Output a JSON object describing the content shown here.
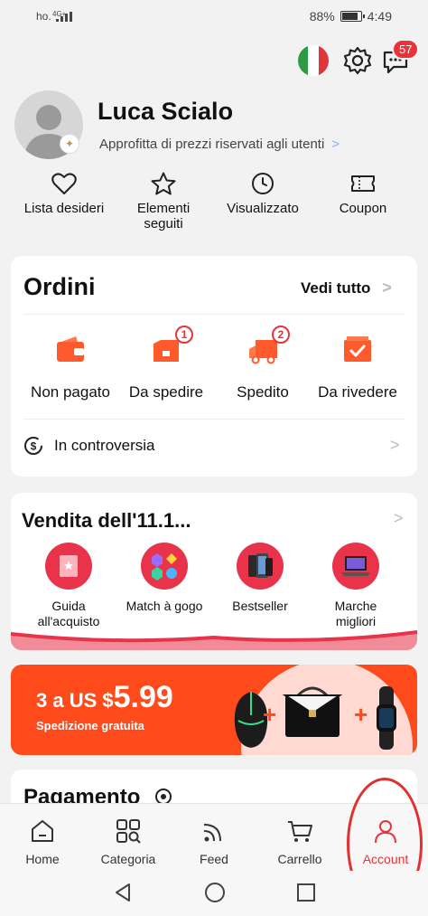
{
  "status_bar": {
    "carrier": "ho.",
    "network": "4G+",
    "battery": "88%",
    "time": "4:49",
    "battery_level": 0.88
  },
  "top_icons": {
    "flag": "italy-flag-icon",
    "settings": "gear-icon",
    "messages": "chat-icon",
    "messages_badge": "57"
  },
  "profile": {
    "name": "Luca Scialo",
    "subtitle": "Approfitta di prezzi riservati agli utenti",
    "subtitle_arrow": ">"
  },
  "quick_links": [
    {
      "label": "Lista desideri",
      "icon": "heart-icon"
    },
    {
      "label": "Elementi seguiti",
      "icon": "star-icon"
    },
    {
      "label": "Visualizzato",
      "icon": "clock-icon"
    },
    {
      "label": "Coupon",
      "icon": "ticket-icon"
    }
  ],
  "orders": {
    "title": "Ordini",
    "see_all": "Vedi tutto",
    "chevron": ">",
    "items": [
      {
        "label": "Non pagato",
        "icon": "wallet-icon",
        "badge": ""
      },
      {
        "label": "Da spedire",
        "icon": "package-icon",
        "badge": "1"
      },
      {
        "label": "Spedito",
        "icon": "truck-icon",
        "badge": "2"
      },
      {
        "label": "Da rivedere",
        "icon": "review-icon",
        "badge": ""
      }
    ],
    "dispute": "In controversia"
  },
  "sale": {
    "title": "Vendita dell'11.1...",
    "chevron": ">",
    "items": [
      {
        "label": "Guida all'acquisto",
        "icon": "book-icon"
      },
      {
        "label": "Match à gogo",
        "icon": "gems-icon"
      },
      {
        "label": "Bestseller",
        "icon": "phones-icon"
      },
      {
        "label": "Marche migliori",
        "icon": "laptop-icon"
      }
    ]
  },
  "promo": {
    "prefix": "3 a US $",
    "price": "5.99",
    "subtitle": "Spedizione gratuita",
    "plus": "+"
  },
  "payment": {
    "title": "Pagamento"
  },
  "bottom_nav": [
    {
      "label": "Home",
      "icon": "home-icon"
    },
    {
      "label": "Categoria",
      "icon": "grid-icon"
    },
    {
      "label": "Feed",
      "icon": "feed-icon"
    },
    {
      "label": "Carrello",
      "icon": "cart-icon"
    },
    {
      "label": "Account",
      "icon": "person-icon"
    }
  ],
  "colors": {
    "accent": "#e8333a",
    "promo": "#ff4a1c",
    "sale_circle": "#e8334a",
    "annotation": "#e03030"
  }
}
